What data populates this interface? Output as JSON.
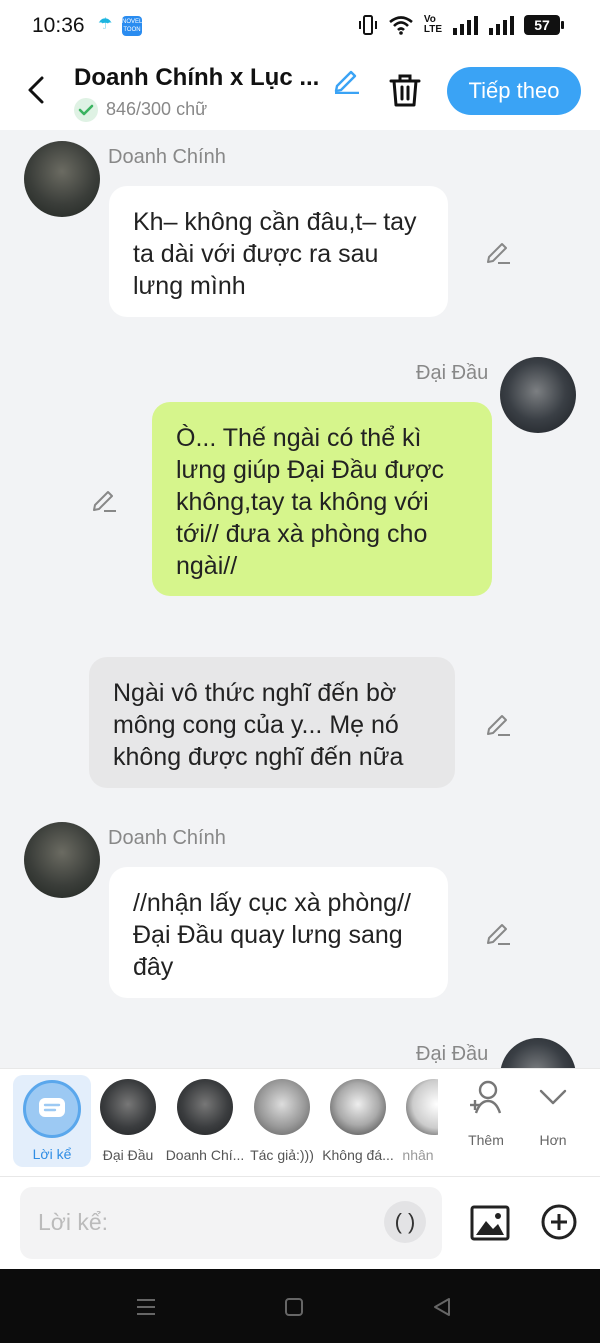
{
  "status_bar": {
    "time": "10:36",
    "app2_text": "NOVEL TOON",
    "network_top": "Vo",
    "network_bottom": "LTE",
    "battery": "57"
  },
  "header": {
    "title": "Doanh Chính x Lục ...",
    "word_count": "846/300 chữ",
    "next_button": "Tiếp theo"
  },
  "messages": [
    {
      "sender": "Doanh Chính",
      "side": "left",
      "text": "Kh– không cần đâu,t– tay ta dài với được ra sau lưng mình"
    },
    {
      "sender": "Đại Đầu",
      "side": "right",
      "text": "Ò... Thế ngài có thể kì lưng giúp Đại Đầu được không,tay ta không với tới// đưa xà phòng cho ngài//"
    },
    {
      "sender": "",
      "side": "narration",
      "text": "Ngài vô thức nghĩ đến bờ mông cong của y... Mẹ nó không được nghĩ đến nữa"
    },
    {
      "sender": "Doanh Chính",
      "side": "left",
      "text": "//nhận lấy cục xà phòng// Đại Đầu quay lưng sang đây"
    },
    {
      "sender": "Đại Đầu",
      "side": "right",
      "text": ""
    }
  ],
  "characters": {
    "narrator": "Lời kể",
    "c1": "Đại Đầu",
    "c2": "Doanh Chí...",
    "c3": "Tác giả:)))",
    "c4": "Không đá...",
    "c5": "nhân",
    "more": "Thêm",
    "less": "Hơn"
  },
  "input": {
    "placeholder": "Lời kể:",
    "paren": "( )"
  },
  "colors": {
    "accent": "#3aa3f5",
    "green_bubble": "#d6f58c",
    "background": "#f2f3f5"
  }
}
